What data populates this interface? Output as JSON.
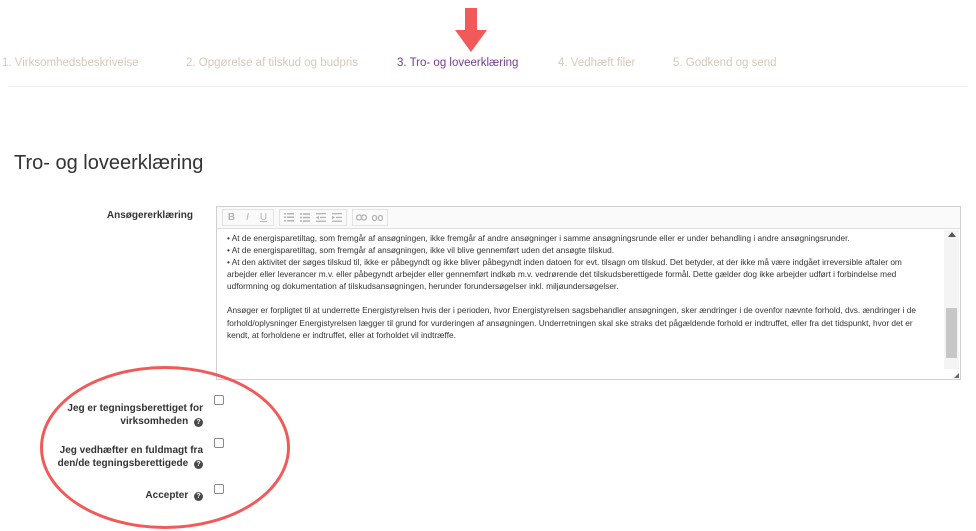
{
  "steps": [
    {
      "label": "1. Virksomhedsbeskrivelse",
      "active": false
    },
    {
      "label": "2. Opgørelse af tilskud og budpris",
      "active": false
    },
    {
      "label": "3. Tro- og loveerklæring",
      "active": true
    },
    {
      "label": "4. Vedhæft filer",
      "active": false
    },
    {
      "label": "5. Godkend og send",
      "active": false
    }
  ],
  "colors": {
    "active_step": "#7a3b8f",
    "inactive_step": "#d7c9b8",
    "annotation": "#f25a5a"
  },
  "page_title": "Tro- og loveerklæring",
  "applicant_declaration": {
    "label": "Ansøgererklæring",
    "toolbar": [
      "B",
      "I",
      "U",
      "ordered-list-icon",
      "unordered-list-icon",
      "outdent-icon",
      "indent-icon",
      "link-icon",
      "unlink-icon"
    ],
    "paragraphs": [
      "• At de energisparetiltag, som fremgår af ansøgningen, ikke fremgår af andre ansøgninger i samme ansøgningsrunde eller er under behandling i andre ansøgningsrunder.",
      "• At de energisparetiltag, som fremgår af ansøgningen, ikke vil blive gennemført uden det ansøgte tilskud.",
      "• At den aktivitet der søges tilskud til, ikke er påbegyndt og ikke bliver påbegyndt inden datoen for evt. tilsagn om tilskud. Det betyder, at der ikke må være indgået irreversible aftaler om arbejder eller leverancer m.v. eller påbegyndt arbejder eller gennemført indkøb m.v. vedrørende det tilskudsberettigede formål. Dette gælder dog ikke arbejder udført i forbindelse med udformning og dokumentation af tilskudsansøgningen, herunder forundersøgelser inkl. miljøundersøgelser.",
      "Ansøger er forpligtet til at underrette Energistyrelsen hvis der i perioden, hvor Energistyrelsen sagsbehandler ansøgningen, sker ændringer i de ovenfor nævnte forhold, dvs. ændringer i de forhold/oplysninger Energistyrelsen lægger til grund for vurderingen af ansøgningen. Underretningen skal ske straks det pågældende forhold er indtruffet, eller fra det tidspunkt, hvor det er kendt, at forholdene er indtruffet, eller at forholdet vil indtræffe."
    ]
  },
  "checkboxes": [
    {
      "label": "Jeg er tegningsberettiget for virksomheden",
      "checked": false
    },
    {
      "label": "Jeg vedhæfter en fuldmagt fra den/de tegningsberettigede",
      "checked": false
    },
    {
      "label": "Accepter",
      "checked": false
    }
  ],
  "help_icon_glyph": "?"
}
